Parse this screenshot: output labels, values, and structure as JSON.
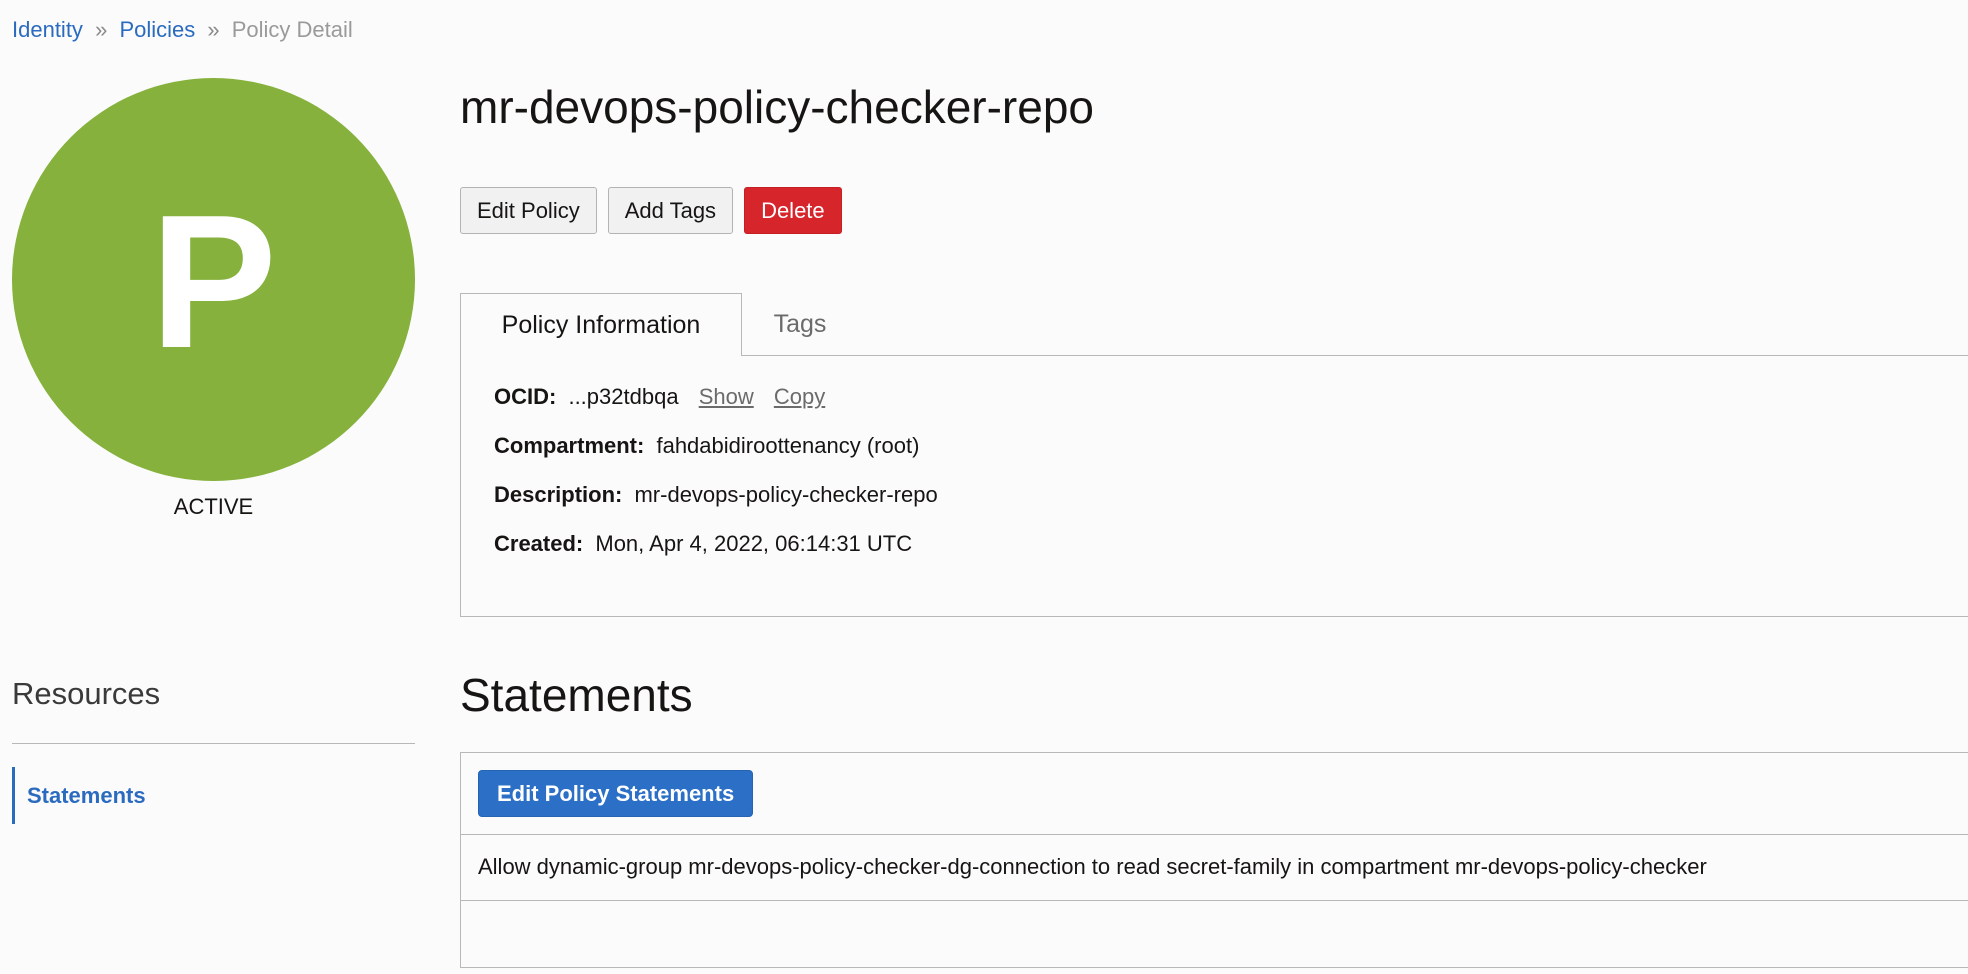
{
  "breadcrumb": {
    "items": [
      {
        "label": "Identity"
      },
      {
        "label": "Policies"
      },
      {
        "label": "Policy Detail"
      }
    ],
    "separator": "»"
  },
  "avatar": {
    "letter": "P",
    "color": "#85b13c",
    "status": "ACTIVE"
  },
  "resources": {
    "heading": "Resources",
    "items": [
      {
        "label": "Statements",
        "active": true
      }
    ]
  },
  "policy": {
    "title": "mr-devops-policy-checker-repo"
  },
  "actions": {
    "edit_label": "Edit Policy",
    "add_tags_label": "Add Tags",
    "delete_label": "Delete"
  },
  "tabs": [
    {
      "label": "Policy Information",
      "active": true
    },
    {
      "label": "Tags",
      "active": false
    }
  ],
  "info": {
    "ocid": {
      "label": "OCID:",
      "value": "...p32tdbqa",
      "show_label": "Show",
      "copy_label": "Copy"
    },
    "compartment": {
      "label": "Compartment:",
      "value": "fahdabidiroottenancy (root)"
    },
    "description": {
      "label": "Description:",
      "value": "mr-devops-policy-checker-repo"
    },
    "created": {
      "label": "Created:",
      "value": "Mon, Apr 4, 2022, 06:14:31 UTC"
    }
  },
  "statements": {
    "heading": "Statements",
    "edit_button_label": "Edit Policy Statements",
    "rows": [
      "Allow dynamic-group mr-devops-policy-checker-dg-connection to read secret-family in compartment mr-devops-policy-checker"
    ]
  },
  "colors": {
    "link": "#2b6bbf",
    "danger": "#d6262c",
    "primary": "#2b6fc6"
  }
}
